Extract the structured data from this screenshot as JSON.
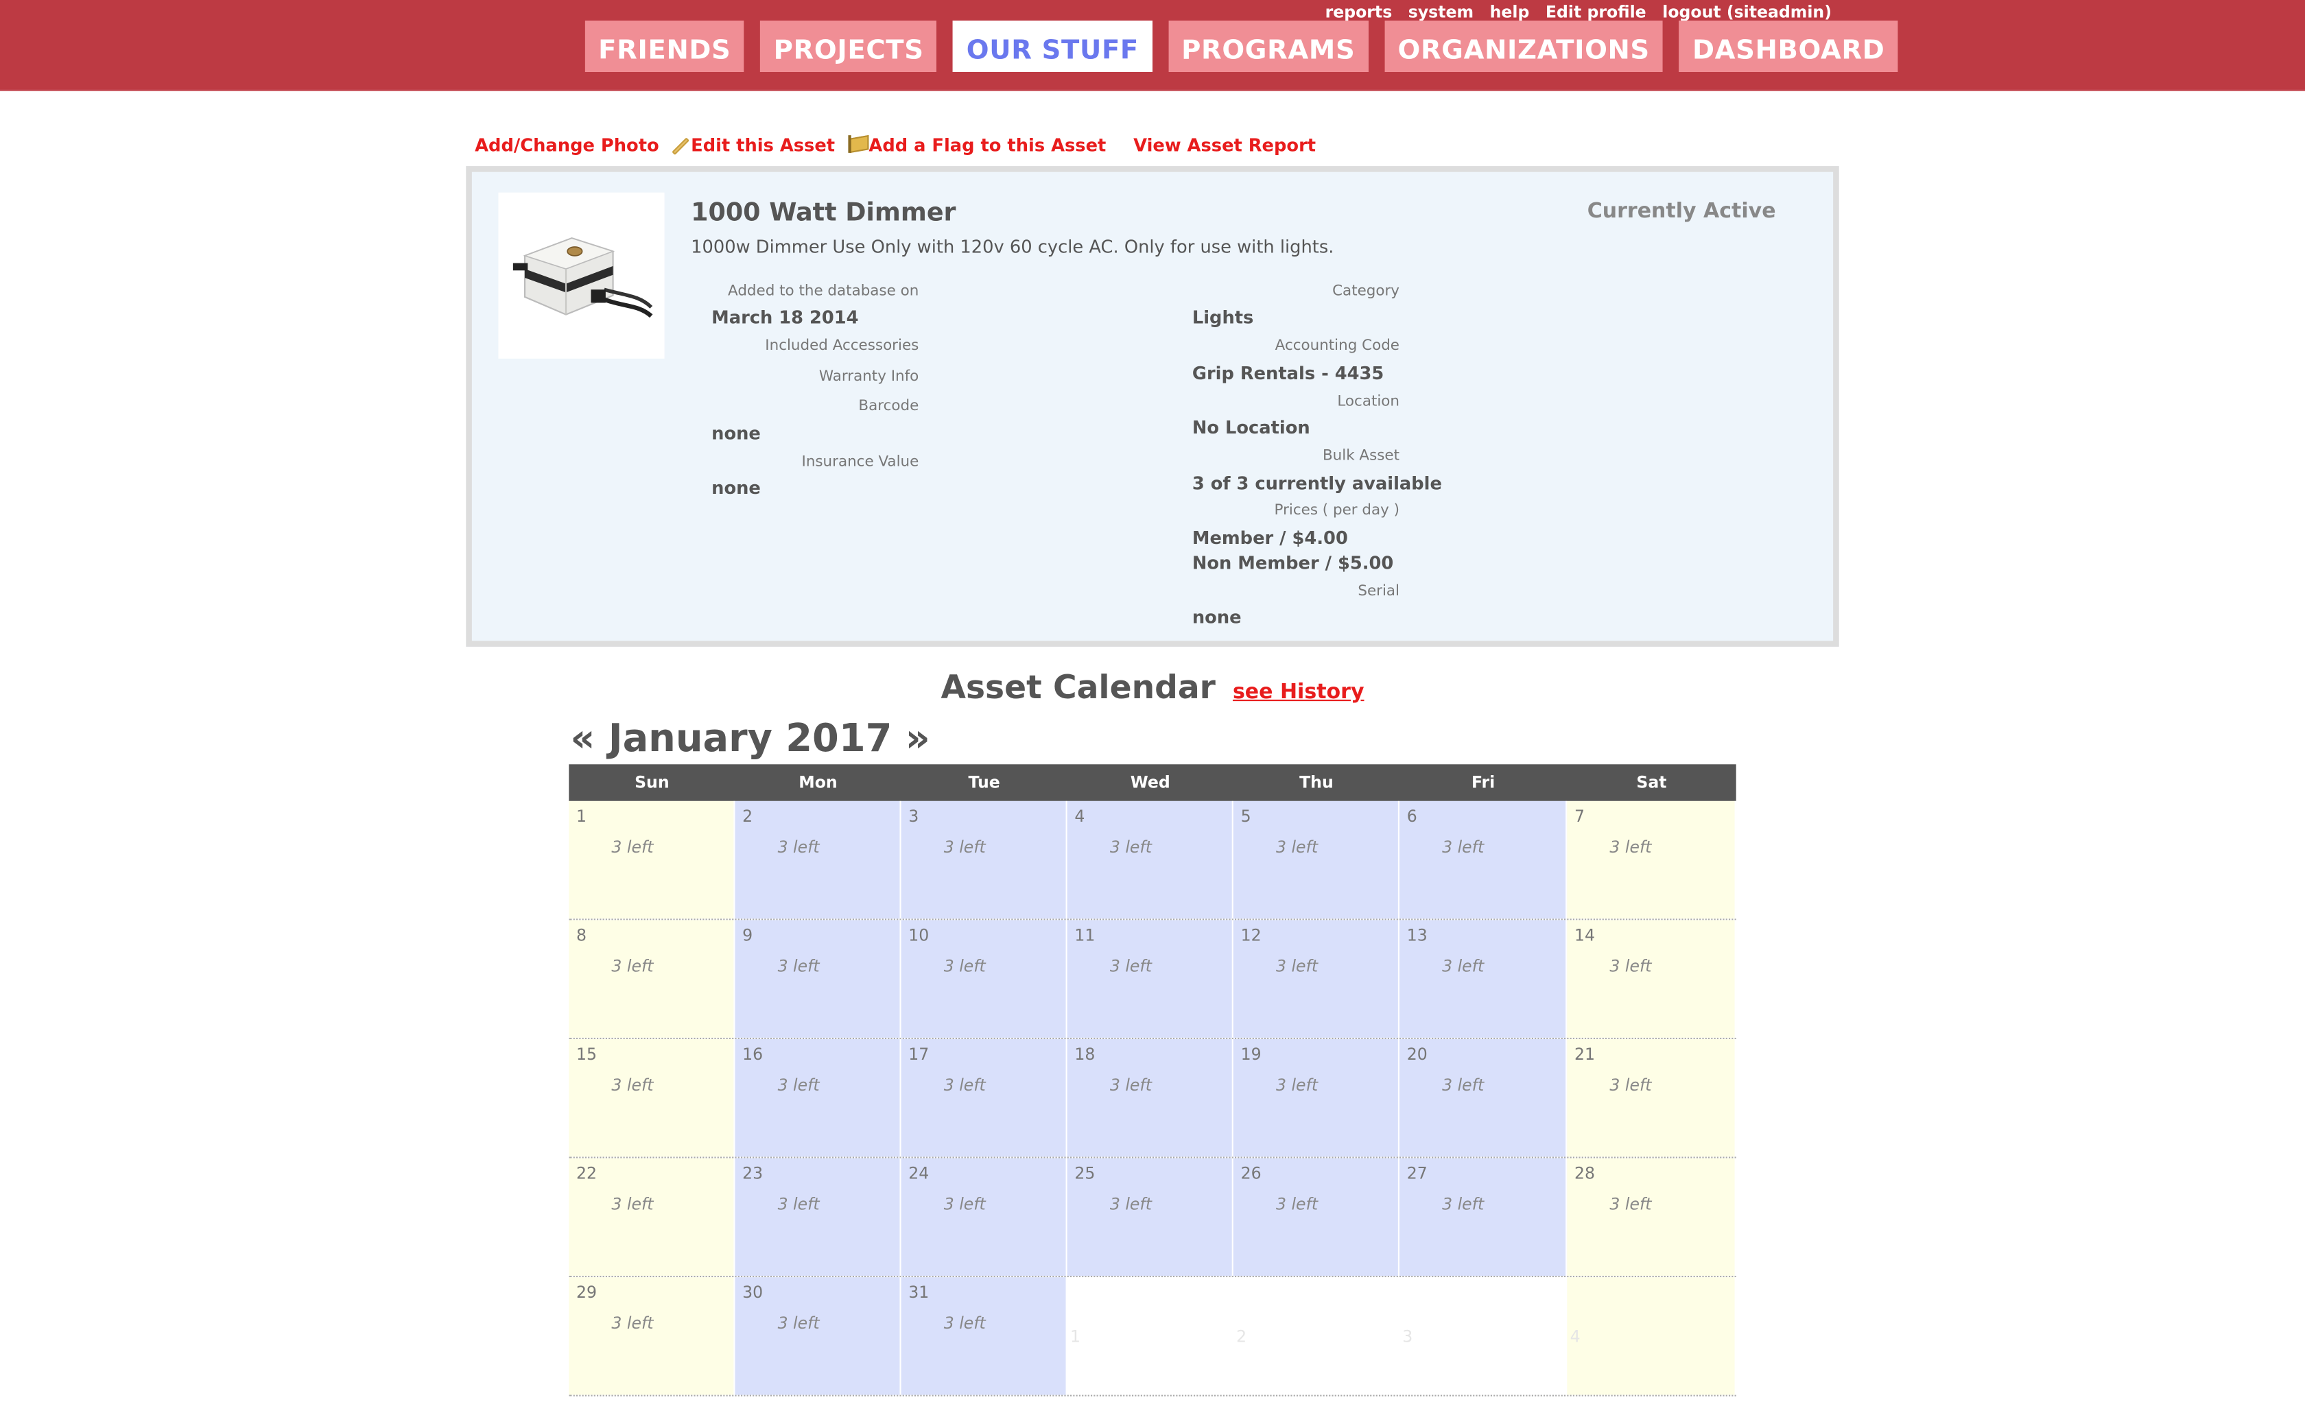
{
  "util_nav": [
    "reports",
    "system",
    "help",
    "Edit profile",
    "logout (siteadmin)"
  ],
  "tabs": [
    {
      "label": "FRIENDS",
      "active": false
    },
    {
      "label": "PROJECTS",
      "active": false
    },
    {
      "label": "OUR STUFF",
      "active": true
    },
    {
      "label": "PROGRAMS",
      "active": false
    },
    {
      "label": "ORGANIZATIONS",
      "active": false
    },
    {
      "label": "DASHBOARD",
      "active": false
    }
  ],
  "actions": {
    "add_photo": "Add/Change Photo",
    "edit": "Edit this Asset",
    "flag": "Add a Flag to this Asset",
    "report": "View Asset Report"
  },
  "asset": {
    "title": "1000 Watt Dimmer",
    "description": "1000w Dimmer Use Only with 120v 60 cycle AC. Only for use with lights.",
    "status": "Currently Active",
    "added_label": "Added to the database on",
    "added_value": "March 18 2014",
    "accessories_label": "Included Accessories",
    "warranty_label": "Warranty Info",
    "barcode_label": "Barcode",
    "barcode_value": "none",
    "insurance_label": "Insurance Value",
    "insurance_value": "none",
    "category_label": "Category",
    "category_value": "Lights",
    "accounting_label": "Accounting Code",
    "accounting_value": "Grip Rentals - 4435",
    "location_label": "Location",
    "location_value": "No Location",
    "bulk_label": "Bulk Asset",
    "bulk_value": "3 of 3 currently available",
    "prices_label": "Prices ( per day )",
    "price_member": "Member / $4.00",
    "price_nonmember": "Non Member / $5.00",
    "serial_label": "Serial",
    "serial_value": "none"
  },
  "calendar": {
    "heading": "Asset Calendar",
    "history_link": "see History",
    "prev": "«",
    "month": "January 2017",
    "next": "»",
    "weekdays": [
      "Sun",
      "Mon",
      "Tue",
      "Wed",
      "Thu",
      "Fri",
      "Sat"
    ],
    "weeks": [
      [
        {
          "d": "1",
          "t": "3 left"
        },
        {
          "d": "2",
          "t": "3 left"
        },
        {
          "d": "3",
          "t": "3 left"
        },
        {
          "d": "4",
          "t": "3 left"
        },
        {
          "d": "5",
          "t": "3 left"
        },
        {
          "d": "6",
          "t": "3 left"
        },
        {
          "d": "7",
          "t": "3 left"
        }
      ],
      [
        {
          "d": "8",
          "t": "3 left"
        },
        {
          "d": "9",
          "t": "3 left"
        },
        {
          "d": "10",
          "t": "3 left"
        },
        {
          "d": "11",
          "t": "3 left"
        },
        {
          "d": "12",
          "t": "3 left"
        },
        {
          "d": "13",
          "t": "3 left"
        },
        {
          "d": "14",
          "t": "3 left"
        }
      ],
      [
        {
          "d": "15",
          "t": "3 left"
        },
        {
          "d": "16",
          "t": "3 left"
        },
        {
          "d": "17",
          "t": "3 left"
        },
        {
          "d": "18",
          "t": "3 left"
        },
        {
          "d": "19",
          "t": "3 left"
        },
        {
          "d": "20",
          "t": "3 left"
        },
        {
          "d": "21",
          "t": "3 left"
        }
      ],
      [
        {
          "d": "22",
          "t": "3 left"
        },
        {
          "d": "23",
          "t": "3 left"
        },
        {
          "d": "24",
          "t": "3 left"
        },
        {
          "d": "25",
          "t": "3 left"
        },
        {
          "d": "26",
          "t": "3 left"
        },
        {
          "d": "27",
          "t": "3 left"
        },
        {
          "d": "28",
          "t": "3 left"
        }
      ],
      [
        {
          "d": "29",
          "t": "3 left"
        },
        {
          "d": "30",
          "t": "3 left"
        },
        {
          "d": "31",
          "t": "3 left"
        },
        {
          "d": "1",
          "t": "",
          "empty": true
        },
        {
          "d": "2",
          "t": "",
          "empty": true
        },
        {
          "d": "3",
          "t": "",
          "empty": true
        },
        {
          "d": "4",
          "t": "",
          "empty": true
        }
      ]
    ]
  },
  "colors": {
    "header": "#bd3a43",
    "tab": "#f08e95",
    "tab_active_text": "#6a78ee",
    "link": "#e81c1c",
    "weekday_cell": "#d9e0fb",
    "weekend_cell": "#fefee6"
  }
}
